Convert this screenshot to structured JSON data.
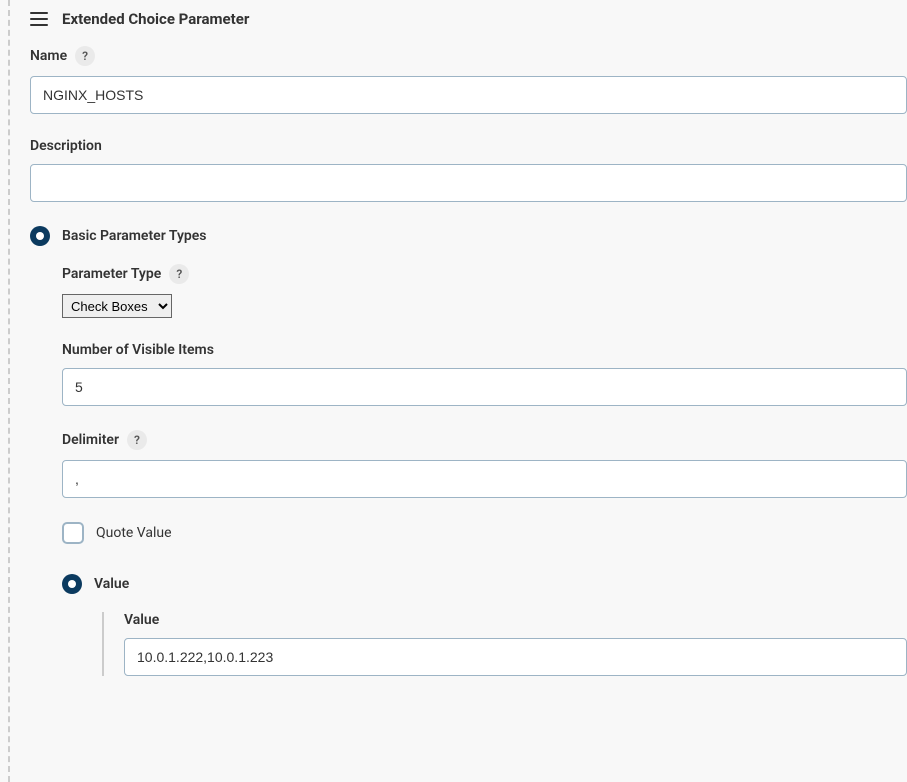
{
  "header": {
    "title": "Extended Choice Parameter"
  },
  "fields": {
    "name": {
      "label": "Name",
      "value": "NGINX_HOSTS"
    },
    "description": {
      "label": "Description",
      "value": ""
    }
  },
  "basicTypes": {
    "label": "Basic Parameter Types",
    "parameterType": {
      "label": "Parameter Type",
      "selected": "Check Boxes"
    },
    "visibleItems": {
      "label": "Number of Visible Items",
      "value": "5"
    },
    "delimiter": {
      "label": "Delimiter",
      "value": ","
    },
    "quoteValue": {
      "label": "Quote Value"
    },
    "valueSection": {
      "label": "Value",
      "value": {
        "label": "Value",
        "text": "10.0.1.222,10.0.1.223"
      }
    }
  },
  "helpGlyph": "?"
}
